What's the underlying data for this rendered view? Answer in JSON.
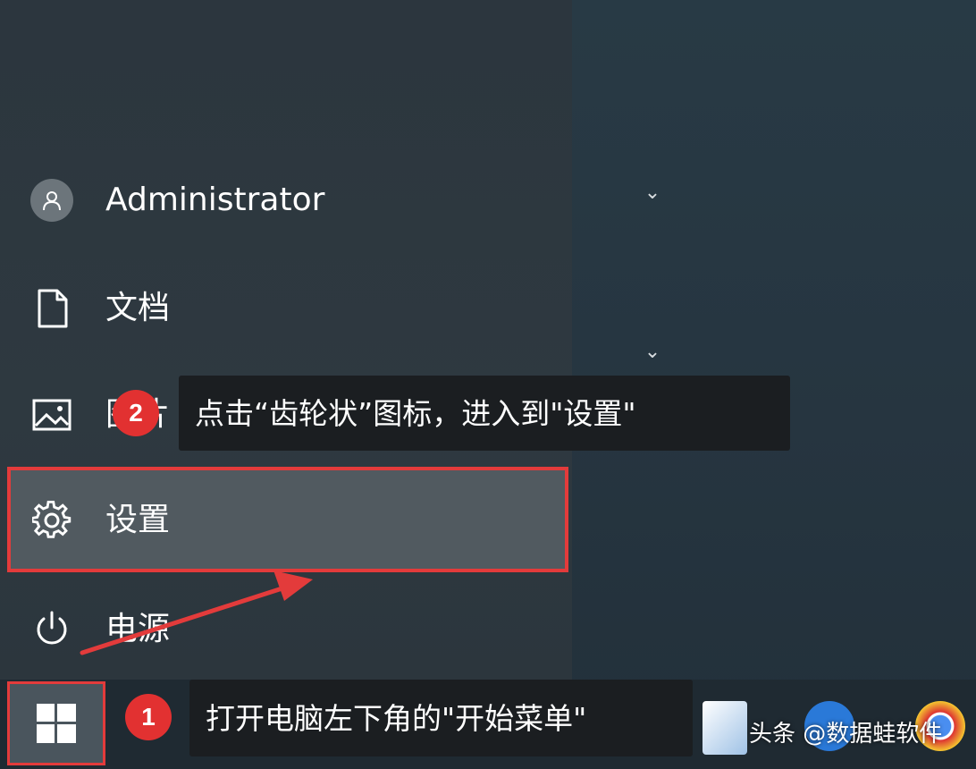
{
  "user": {
    "name": "Administrator"
  },
  "menu": {
    "documents_label": "文档",
    "pictures_label": "图片",
    "settings_label": "设置",
    "power_label": "电源"
  },
  "callouts": {
    "step2_number": "2",
    "step2_text": "点击“齿轮状”图标，进入到\"设置\"",
    "step1_number": "1",
    "step1_text": "打开电脑左下角的\"开始菜单\""
  },
  "watermark": "头条 @数据蛙软件",
  "icons": {
    "avatar": "user-icon",
    "documents": "document-icon",
    "pictures": "picture-icon",
    "settings": "gear-icon",
    "power": "power-icon",
    "start": "windows-logo-icon"
  },
  "colors": {
    "highlight_border": "#e33b3b",
    "badge": "#e23131",
    "callout_bg": "#1b1e21"
  }
}
